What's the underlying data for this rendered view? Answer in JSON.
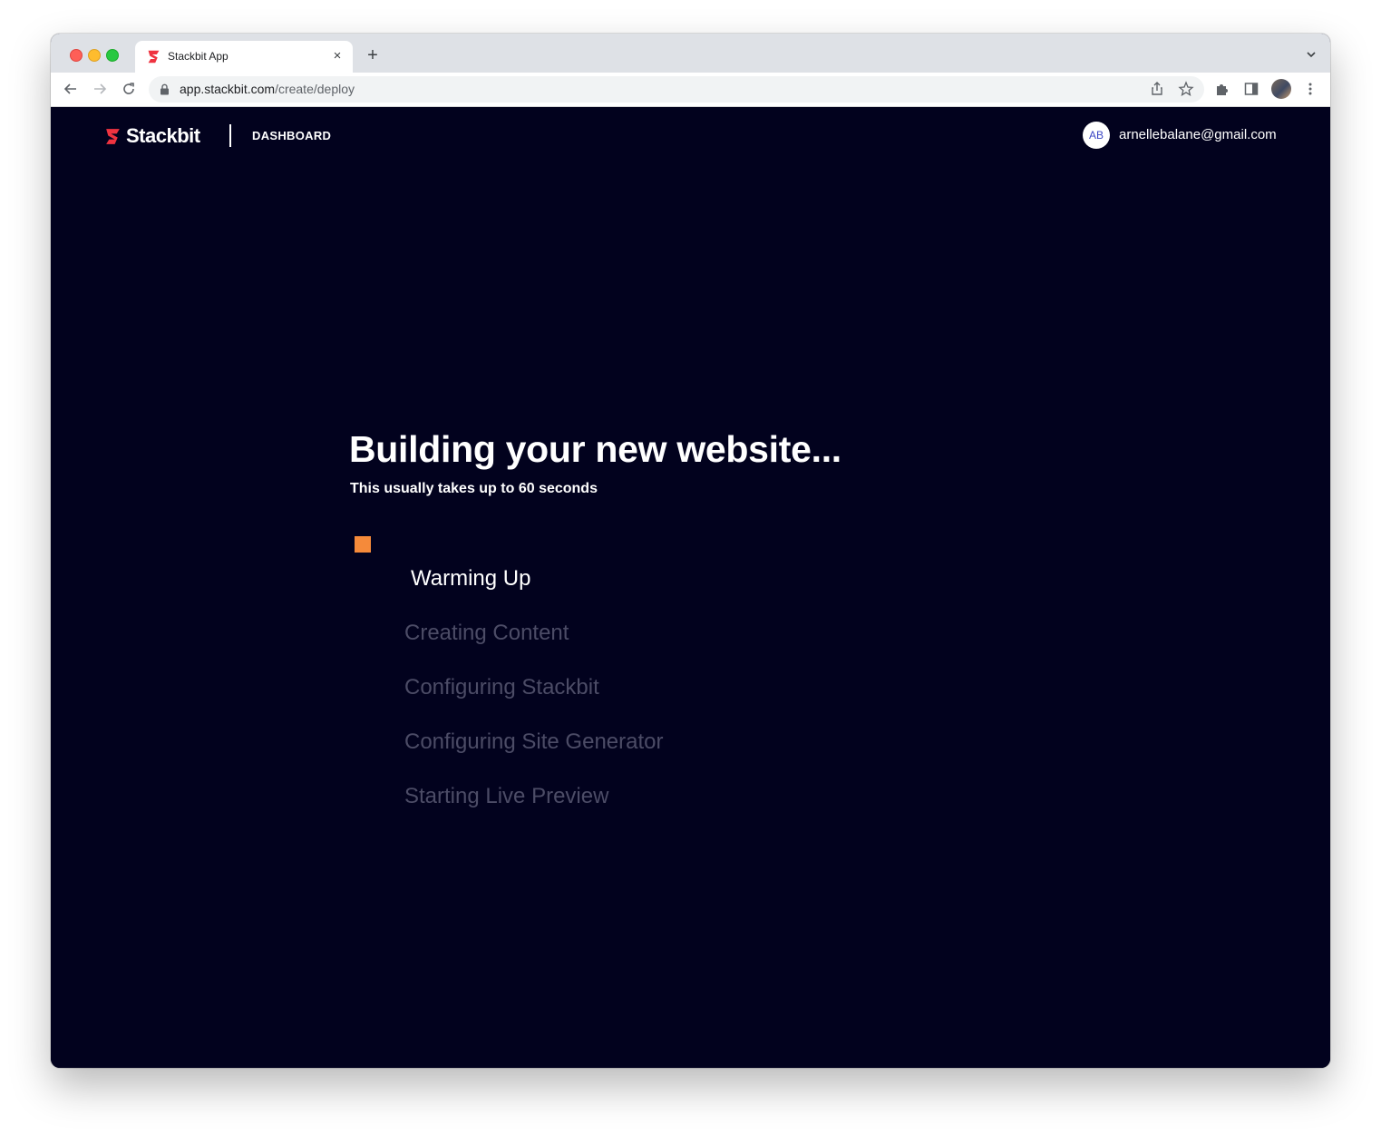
{
  "browser": {
    "tab_title": "Stackbit App",
    "tab_close": "×",
    "new_tab": "+",
    "url_host": "app.stackbit.com",
    "url_path": "/create/deploy"
  },
  "header": {
    "brand_name": "Stackbit",
    "dashboard_label": "DASHBOARD",
    "avatar_initials": "AB",
    "user_email": "arnellebalane@gmail.com"
  },
  "main": {
    "title": "Building your new website...",
    "subtitle": "This usually takes up to 60 seconds",
    "steps": [
      {
        "label": "Warming Up",
        "state": "active"
      },
      {
        "label": "Creating Content",
        "state": "pending"
      },
      {
        "label": "Configuring Stackbit",
        "state": "pending"
      },
      {
        "label": "Configuring Site Generator",
        "state": "pending"
      },
      {
        "label": "Starting Live Preview",
        "state": "pending"
      }
    ]
  },
  "colors": {
    "page_background": "#02021e",
    "accent_marker": "#f58a3a",
    "brand_red": "#ef3340",
    "pending_text": "#4c4c66",
    "avatar_text": "#3b46c4"
  },
  "icons": {
    "favicon": "stackbit-logo-icon",
    "back": "arrow-left-icon",
    "forward": "arrow-right-icon",
    "reload": "reload-icon",
    "lock": "lock-icon",
    "share": "share-icon",
    "bookmark": "star-icon",
    "extensions": "puzzle-icon",
    "sidepanel": "side-panel-icon",
    "menu": "kebab-menu-icon",
    "tab_list": "chevron-down-icon"
  }
}
